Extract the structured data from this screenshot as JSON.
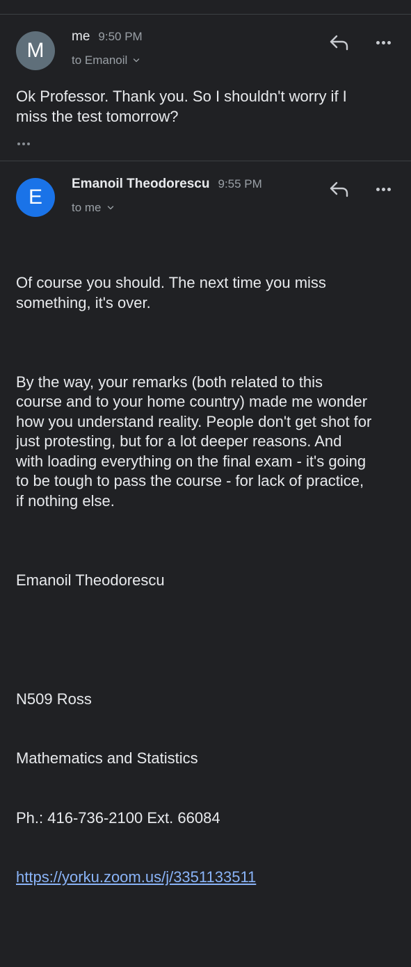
{
  "messages": [
    {
      "avatar_initial": "M",
      "sender": "me",
      "time": "9:50 PM",
      "recipient": "to Emanoil",
      "body": "Ok Professor. Thank you. So I shouldn't worry if I\nmiss the test tomorrow?",
      "icons": {
        "reply": "reply-icon",
        "more": "more-options-icon",
        "quoted": "show-quoted-text-icon"
      },
      "avatar_color": "#5f6f7a"
    },
    {
      "avatar_initial": "E",
      "sender": "Emanoil Theodorescu",
      "time": "9:55 PM",
      "recipient": "to me",
      "paragraphs": [
        "Of course you should. The next time you miss\nsomething, it's over.",
        "By the way, your remarks (both related to this\ncourse and to your home country) made me wonder\nhow you understand reality. People don't get shot for\njust protesting, but for a lot deeper reasons. And\nwith loading everything on the final exam - it's going\nto be tough to pass the course - for lack of practice,\nif nothing else.",
        "Emanoil Theodorescu"
      ],
      "signature": {
        "office": "N509 Ross",
        "department": "Mathematics and Statistics",
        "phone": "Ph.: 416-736-2100 Ext. 66084",
        "link": "https://yorku.zoom.us/j/3351133511"
      },
      "icons": {
        "reply": "reply-icon",
        "more": "more-options-icon"
      },
      "avatar_color": "#1a73e8"
    }
  ],
  "colors": {
    "background": "#202124",
    "text": "#e8eaed",
    "secondary_text": "#9aa0a6",
    "link": "#8ab4f8"
  }
}
